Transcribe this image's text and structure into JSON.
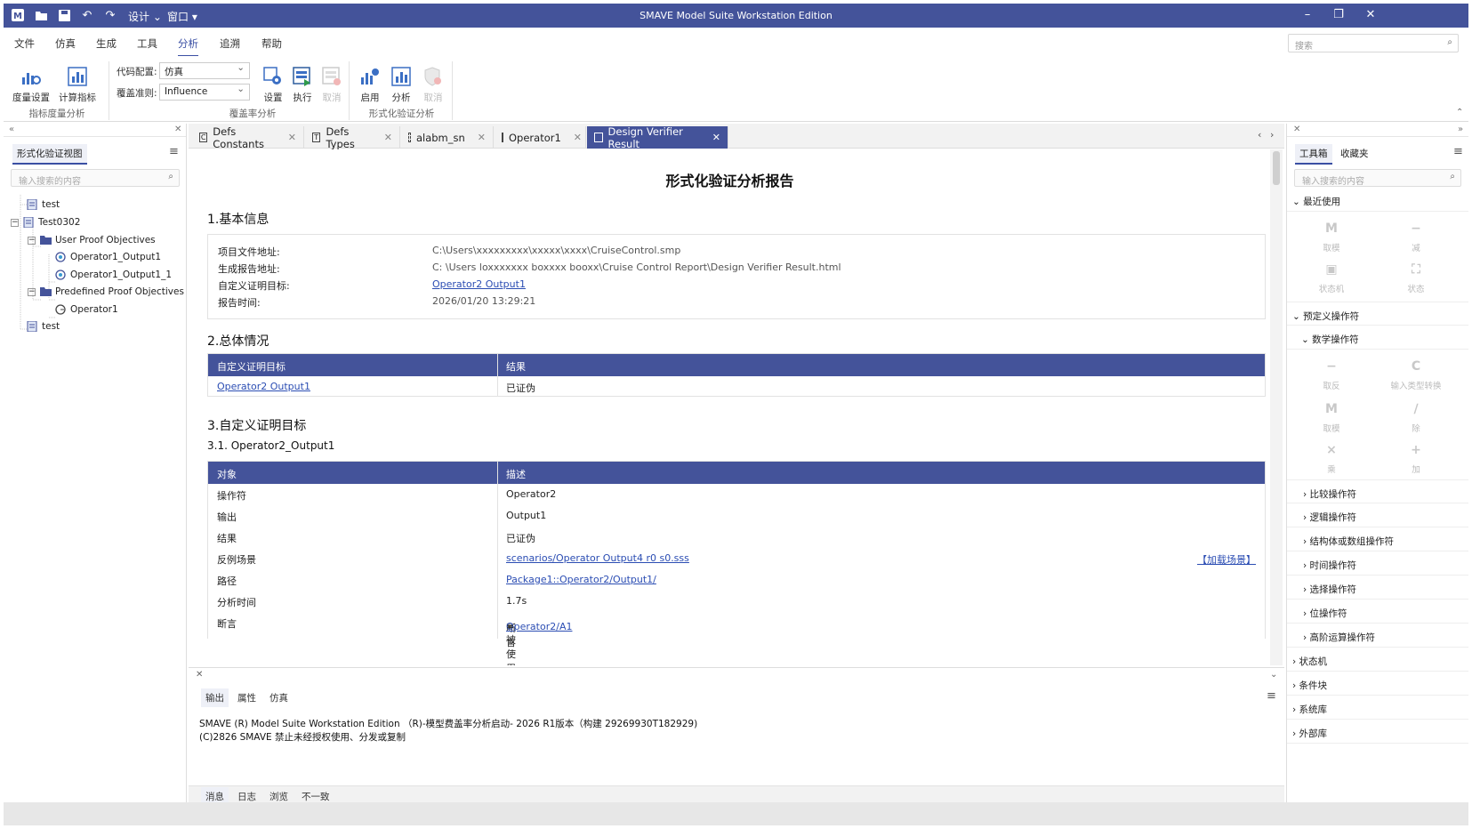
{
  "app": {
    "title": "SMAVE Model Suite Workstation Edition"
  },
  "titlebar": {
    "design_menu": "设计",
    "window_menu": "窗口"
  },
  "menu": {
    "items": [
      "文件",
      "仿真",
      "生成",
      "工具",
      "分析",
      "追溯",
      "帮助"
    ],
    "active": "分析",
    "search_placeholder": "搜索"
  },
  "ribbon": {
    "metric_group": {
      "label": "指标度量分析",
      "btn1": "度量设置",
      "btn2": "计算指标"
    },
    "coverage_group": {
      "label": "覆盖率分析",
      "code_config_label": "代码配置:",
      "code_config_value": "仿真",
      "criterion_label": "覆盖准则:",
      "criterion_value": "Influence",
      "btn_settings": "设置",
      "btn_execute": "执行",
      "btn_cancel": "取消"
    },
    "formal_group": {
      "label": "形式化验证分析",
      "btn_enable": "启用",
      "btn_analyze": "分析",
      "btn_cancel": "取消"
    }
  },
  "left_panel": {
    "tab": "形式化验证视图",
    "search_placeholder": "输入搜索的内容",
    "tree": [
      "test",
      "Test0302",
      "User Proof Objectives",
      "Operator1_Output1",
      "Operator1_Output1_1",
      "Predefined Proof Objectives",
      "Operator1",
      "test"
    ]
  },
  "doc_tabs": [
    "Defs Constants",
    "Defs Types",
    "alabm_sn",
    "Operator1",
    "Design Verifier Result"
  ],
  "report": {
    "title": "形式化验证分析报告",
    "s1": "1.基本信息",
    "info": [
      {
        "k": "项目文件地址:",
        "v": "C:\\Users\\xxxxxxxxx\\xxxxx\\xxxx\\CruiseControl.smp"
      },
      {
        "k": "生成报告地址:",
        "v": "C: \\Users loxxxxxxx boxxxx booxx\\Cruise Control Report\\Design Verifier Result.html"
      },
      {
        "k": "自定义证明目标:",
        "v": "Operator2 Output1"
      },
      {
        "k": "报告时间:",
        "v": "2026/01/20 13:29:21"
      }
    ],
    "s2": "2.总体情况",
    "summary_head": [
      "自定义证明目标",
      "结果"
    ],
    "summary_row": [
      "Operator2 Output1",
      "已证伪"
    ],
    "s3": "3.自定义证明目标",
    "s31": "3.1. Operator2_Output1",
    "detail_head": [
      "对象",
      "描述"
    ],
    "detail_rows": [
      {
        "k": "操作符",
        "v": "Operator2"
      },
      {
        "k": "输出",
        "v": "Output1"
      },
      {
        "k": "结果",
        "v": "已证伪"
      },
      {
        "k": "反例场景",
        "v": "scenarios/Operator Output4 r0 s0.sss",
        "extra": "【加载场景】"
      },
      {
        "k": "路径",
        "v": "Package1::Operator2/Output1/"
      },
      {
        "k": "分析时间",
        "v": "1.7s"
      },
      {
        "k": "断言",
        "v_pre": "断言 ",
        "v": "Operator2/A1",
        "v_post": "= 被使用到"
      }
    ]
  },
  "bottom": {
    "tabs": [
      "输出",
      "属性",
      "仿真"
    ],
    "lines": [
      "SMAVE (R) Model Suite Workstation Edition （R)-模型费盖率分析启动- 2026 R1版本（构建 29269930T182929)",
      "(C)2826 SMAVE 禁止未经授权使用、分发或复制"
    ],
    "footer_tabs": [
      "消息",
      "日志",
      "浏览",
      "不一致"
    ]
  },
  "right_panel": {
    "tabs": [
      "工具箱",
      "收藏夹"
    ],
    "search_placeholder": "输入搜索的内容",
    "recent": "最近使用",
    "recent_ops": [
      "取模",
      "减",
      "状态机",
      "状态"
    ],
    "predefined": "预定义操作符",
    "math": "数学操作符",
    "math_ops": [
      "取反",
      "输入类型转换",
      "取模",
      "除",
      "乘",
      "加"
    ],
    "categories": [
      "比较操作符",
      "逻辑操作符",
      "结构体或数组操作符",
      "时间操作符",
      "选择操作符",
      "位操作符",
      "高阶运算操作符"
    ],
    "top_categories": [
      "状态机",
      "条件块",
      "系统库",
      "外部库"
    ]
  },
  "colors": {
    "accent": "#44539a",
    "link": "#2b4db3"
  }
}
